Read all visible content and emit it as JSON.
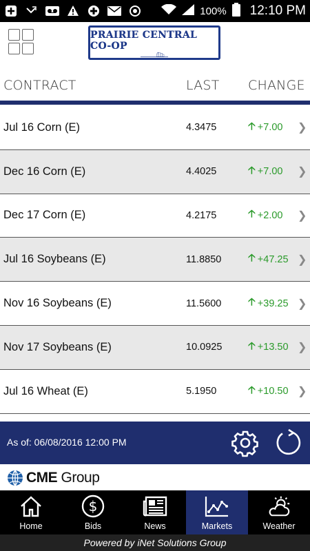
{
  "status_bar": {
    "battery": "100%",
    "time": "12:10 PM"
  },
  "header": {
    "logo_text": "PRAIRIE CENTRAL CO-OP"
  },
  "columns": {
    "contract": "CONTRACT",
    "last": "LAST",
    "change": "CHANGE"
  },
  "rows": [
    {
      "contract": "Jul 16 Corn (E)",
      "last": "4.3475",
      "change": "+7.00"
    },
    {
      "contract": "Dec 16 Corn (E)",
      "last": "4.4025",
      "change": "+7.00"
    },
    {
      "contract": "Dec 17 Corn (E)",
      "last": "4.2175",
      "change": "+2.00"
    },
    {
      "contract": "Jul 16 Soybeans (E)",
      "last": "11.8850",
      "change": "+47.25"
    },
    {
      "contract": "Nov 16 Soybeans (E)",
      "last": "11.5600",
      "change": "+39.25"
    },
    {
      "contract": "Nov 17 Soybeans (E)",
      "last": "10.0925",
      "change": "+13.50"
    },
    {
      "contract": "Jul 16 Wheat (E)",
      "last": "5.1950",
      "change": "+10.50"
    }
  ],
  "info": {
    "as_of": "As of: 06/08/2016 12:00 PM"
  },
  "cme": {
    "brand": "CME",
    "group": "Group"
  },
  "tabs": [
    {
      "label": "Home",
      "icon": "home-icon"
    },
    {
      "label": "Bids",
      "icon": "dollar-icon"
    },
    {
      "label": "News",
      "icon": "newspaper-icon"
    },
    {
      "label": "Markets",
      "icon": "chart-icon"
    },
    {
      "label": "Weather",
      "icon": "weather-icon"
    }
  ],
  "active_tab": "Markets",
  "footer": {
    "text": "Powered by iNet Solutions Group"
  },
  "colors": {
    "brand_navy": "#1f2e6e",
    "up_green": "#2a9a2a"
  }
}
